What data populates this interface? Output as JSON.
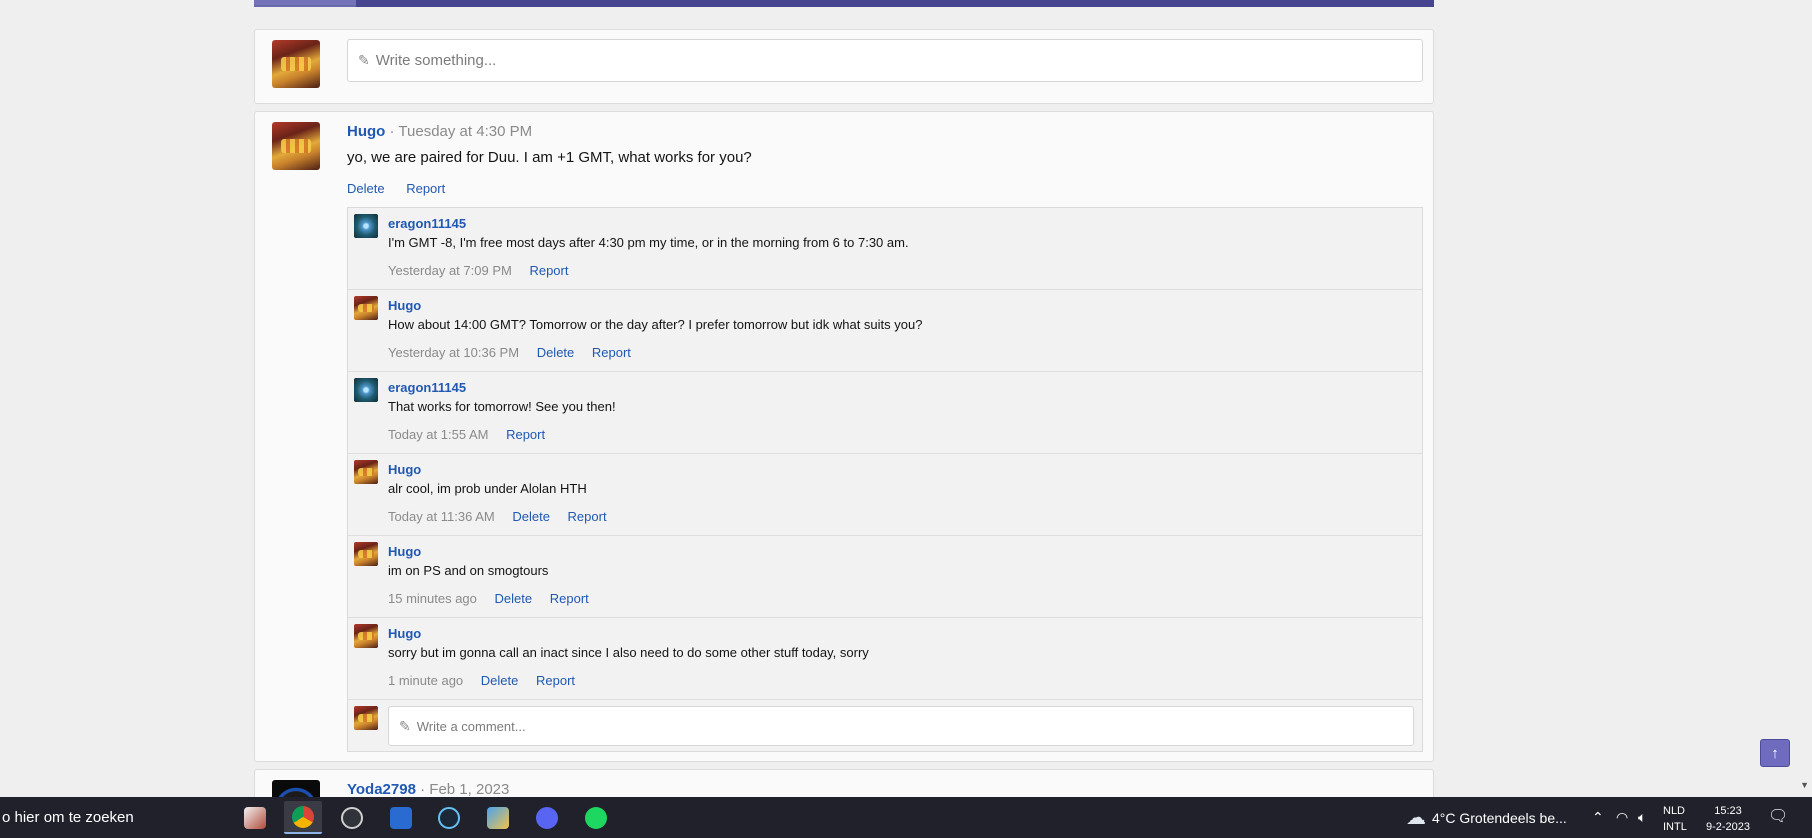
{
  "composer": {
    "placeholder": "Write something..."
  },
  "post": {
    "author": "Hugo",
    "separator": "·",
    "time": "Tuesday at 4:30 PM",
    "body": "yo, we are paired for Duu. I am +1 GMT, what works for you?",
    "actions": [
      "Delete",
      "Report"
    ]
  },
  "comments": [
    {
      "author": "eragon11145",
      "avatar": "eragon",
      "text": "I'm GMT -8, I'm free most days after 4:30 pm my time, or in the morning from 6 to 7:30 am.",
      "time": "Yesterday at 7:09 PM",
      "actions": [
        "Report"
      ]
    },
    {
      "author": "Hugo",
      "avatar": "hugo",
      "text": "How about 14:00 GMT? Tomorrow or the day after? I prefer tomorrow but idk what suits you?",
      "time": "Yesterday at 10:36 PM",
      "actions": [
        "Delete",
        "Report"
      ]
    },
    {
      "author": "eragon11145",
      "avatar": "eragon",
      "text": "That works for tomorrow! See you then!",
      "time": "Today at 1:55 AM",
      "actions": [
        "Report"
      ]
    },
    {
      "author": "Hugo",
      "avatar": "hugo",
      "text": "alr cool, im prob under Alolan HTH",
      "time": "Today at 11:36 AM",
      "actions": [
        "Delete",
        "Report"
      ]
    },
    {
      "author": "Hugo",
      "avatar": "hugo",
      "text": "im on PS and on smogtours",
      "time": "15 minutes ago",
      "actions": [
        "Delete",
        "Report"
      ]
    },
    {
      "author": "Hugo",
      "avatar": "hugo",
      "text": "sorry but im gonna call an inact since I also need to do some other stuff today, sorry",
      "time": "1 minute ago",
      "actions": [
        "Delete",
        "Report"
      ]
    }
  ],
  "comment_composer": {
    "placeholder": "Write a comment..."
  },
  "next_post": {
    "author": "Yoda2798",
    "separator": "·",
    "time": "Feb 1, 2023"
  },
  "scroll_top": {
    "icon": "arrow-up-icon",
    "glyph": "↑"
  },
  "taskbar": {
    "search_text": "o hier om te zoeken",
    "apps": [
      {
        "name": "unknown-app-icon",
        "color": "#d8d8d8"
      },
      {
        "name": "chrome-icon",
        "color": "#e8b71b"
      },
      {
        "name": "obs-icon",
        "color": "#444850"
      },
      {
        "name": "video-editor-icon",
        "color": "#2a6bd1"
      },
      {
        "name": "steam-icon",
        "color": "#1b2838"
      },
      {
        "name": "control-panel-icon",
        "color": "#3e83d6"
      },
      {
        "name": "discord-icon",
        "color": "#5865f2"
      },
      {
        "name": "spotify-icon",
        "color": "#1ed760"
      }
    ],
    "weather": "4°C  Grotendeels be...",
    "lang_top": "NLD",
    "lang_bottom": "INTL",
    "time": "15:23",
    "date": "9-2-2023"
  }
}
